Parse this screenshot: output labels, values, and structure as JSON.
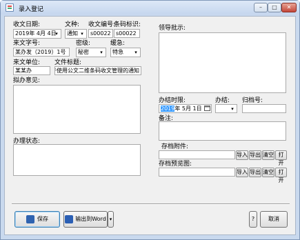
{
  "window": {
    "title": "录入登记",
    "min_glyph": "–",
    "max_glyph": "□",
    "close_glyph": "✕"
  },
  "fields": {
    "receive_date": {
      "label": "收文日期:",
      "value": "2019年 4月 4日",
      "arrow": "▾"
    },
    "doc_type": {
      "label": "文种:",
      "value": "通知",
      "arrow": "▾"
    },
    "receive_no": {
      "label": "收文编号:",
      "value": "s00022"
    },
    "barcode": {
      "label": "条码标识:",
      "value": "s00022"
    },
    "source_no": {
      "label": "来文字号:",
      "value": "某办发（2019）1号"
    },
    "secret_level": {
      "label": "密级:",
      "value": "秘密",
      "arrow": "▾"
    },
    "urgency": {
      "label": "缓急:",
      "value": "特急",
      "arrow": "▾"
    },
    "source_unit": {
      "label": "来文单位:",
      "value": "某某办"
    },
    "doc_title": {
      "label": "文件标题:",
      "value": "关于使用公文二维条码收文管理的通知"
    },
    "draft_opinion": {
      "label": "拟办意见:",
      "value": ""
    },
    "handling_status": {
      "label": "办理状态:",
      "value": ""
    },
    "leader_instruction": {
      "label": "领导批示:",
      "value": ""
    },
    "deadline": {
      "label": "办结时限:",
      "year": "2019",
      "rest": "年  5月  1日"
    },
    "done": {
      "label": "办结:",
      "value": "",
      "arrow": "▾"
    },
    "archive_no": {
      "label": "归档号:",
      "value": ""
    },
    "remark": {
      "label": "备注:",
      "value": ""
    },
    "archive_attachment": {
      "label": "存档附件:",
      "value": ""
    },
    "archive_preview": {
      "label": "存档预览图:",
      "value": ""
    }
  },
  "file_buttons": {
    "import": "导入",
    "export": "导出",
    "clear": "清空",
    "open": "打开"
  },
  "footer": {
    "save": "保存",
    "export_word": "输出到Word",
    "dropdown_arrow": "▾",
    "help": "?",
    "cancel": "取消"
  },
  "accent": {
    "selection": "#3399ff",
    "primary_border": "#3c7fb1"
  }
}
